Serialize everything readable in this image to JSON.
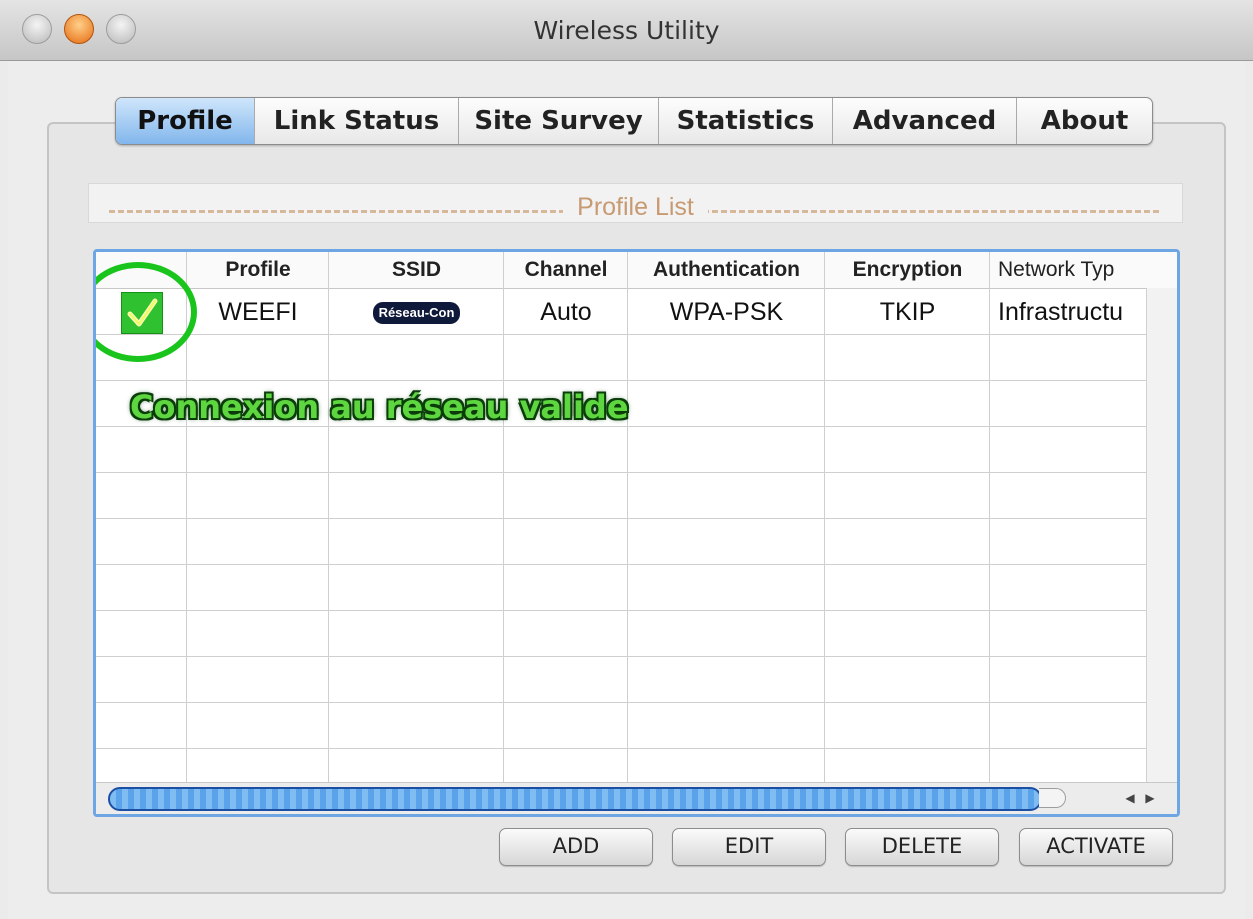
{
  "window": {
    "title": "Wireless Utility"
  },
  "tabs": [
    {
      "label": "Profile",
      "active": true
    },
    {
      "label": "Link Status",
      "active": false
    },
    {
      "label": "Site Survey",
      "active": false
    },
    {
      "label": "Statistics",
      "active": false
    },
    {
      "label": "Advanced",
      "active": false
    },
    {
      "label": "About",
      "active": false
    }
  ],
  "profile_list": {
    "title": "Profile List",
    "columns": [
      "Profile",
      "SSID",
      "Channel",
      "Authentication",
      "Encryption",
      "Network Typ"
    ],
    "rows": [
      {
        "active": true,
        "profile": "WEEFI",
        "ssid": "Réseau-Con",
        "channel": "Auto",
        "authentication": "WPA-PSK",
        "encryption": "TKIP",
        "network_type": "Infrastructu"
      }
    ]
  },
  "annotation": "Connexion au réseau valide",
  "buttons": {
    "add": "ADD",
    "edit": "EDIT",
    "delete": "DELETE",
    "activate": "ACTIVATE"
  },
  "colors": {
    "active_tab": "#82b6ec",
    "table_border": "#6ea6e3",
    "annotation": "#5ed63f",
    "check": "#2fc12f"
  },
  "icons": [
    "close-light-icon",
    "minimize-light-icon",
    "zoom-light-icon",
    "check-icon",
    "scroll-left-icon",
    "scroll-right-icon"
  ]
}
